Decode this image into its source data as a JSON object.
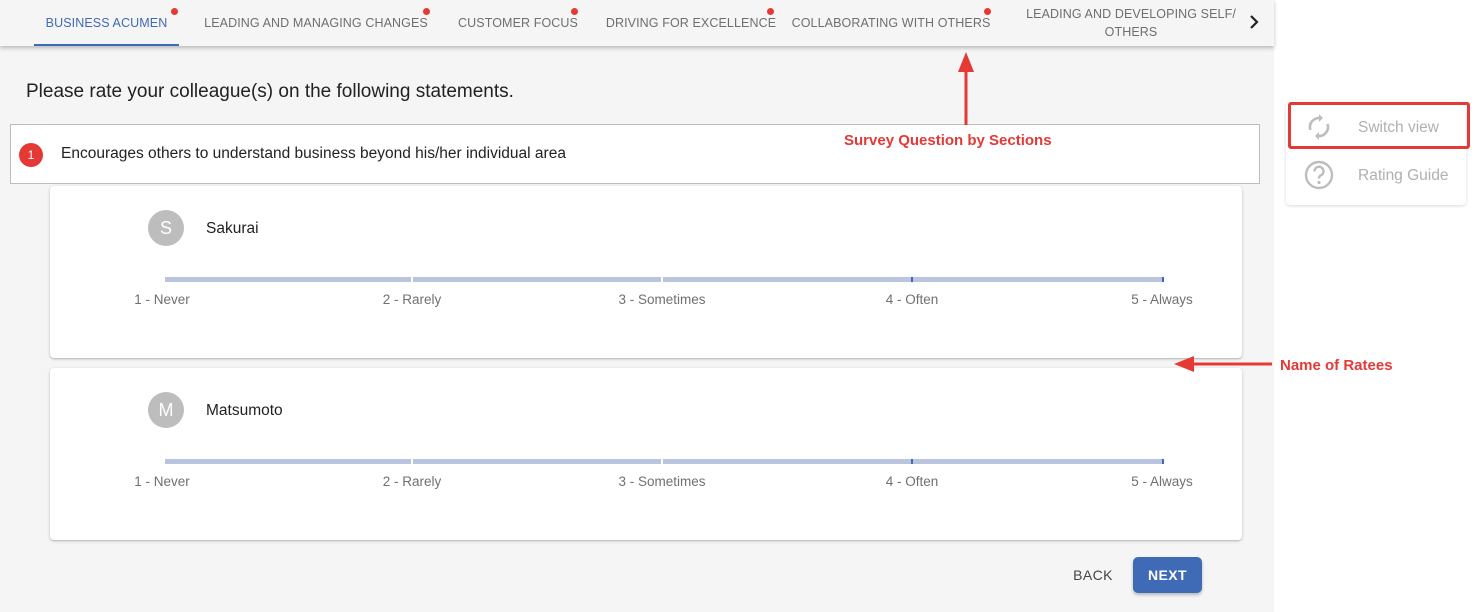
{
  "tabs": [
    {
      "label": "BUSINESS ACUMEN",
      "active": true,
      "has_dot": true
    },
    {
      "label": "LEADING AND MANAGING CHANGES",
      "active": false,
      "has_dot": true
    },
    {
      "label": "CUSTOMER FOCUS",
      "active": false,
      "has_dot": true
    },
    {
      "label": "DRIVING FOR EXCELLENCE",
      "active": false,
      "has_dot": true
    },
    {
      "label": "COLLABORATING WITH OTHERS",
      "active": false,
      "has_dot": true
    },
    {
      "label": "LEADING AND DEVELOPING SELF/ OTHERS",
      "active": false,
      "has_dot": false
    }
  ],
  "tabs_next_icon": "chevron-right-icon",
  "prompt": "Please rate your colleague(s) on the following statements.",
  "question": {
    "number": "1",
    "text": "Encourages others to understand business beyond his/her individual area"
  },
  "scale": [
    "1 - Never",
    "2 - Rarely",
    "3 - Sometimes",
    "4 - Often",
    "5 - Always"
  ],
  "ratees": [
    {
      "initial": "S",
      "name": "Sakurai"
    },
    {
      "initial": "M",
      "name": "Matsumoto"
    }
  ],
  "buttons": {
    "back": "BACK",
    "next": "NEXT"
  },
  "side_panel": {
    "switch_view": {
      "label": "Switch view",
      "icon": "sync-icon"
    },
    "rating_guide": {
      "label": "Rating Guide",
      "icon": "help-circle-icon"
    }
  },
  "annotations": {
    "sections": "Survey Question by Sections",
    "ratees": "Name of Ratees"
  },
  "colors": {
    "accent": "#3f6ab5",
    "alert": "#e53935",
    "track": "#b9c5de"
  }
}
